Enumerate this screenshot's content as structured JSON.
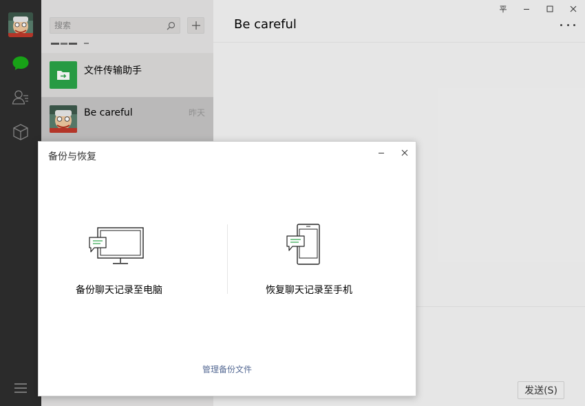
{
  "search": {
    "placeholder": "搜索"
  },
  "chats": [
    {
      "name": "文件传输助手",
      "time": ""
    },
    {
      "name": "Be careful",
      "time": "昨天"
    }
  ],
  "main": {
    "title": "Be careful",
    "send_label": "发送(S)"
  },
  "dialog": {
    "title": "备份与恢复",
    "backup_label": "备份聊天记录至电脑",
    "restore_label": "恢复聊天记录至手机",
    "manage_link": "管理备份文件"
  },
  "window": {
    "pin_glyph": "平"
  },
  "colors": {
    "nav_bg": "#2e2e2e",
    "accent_green": "#1aad19",
    "file_helper_green": "#2aa448",
    "link_blue": "#576b95"
  },
  "icons": [
    "avatar-icon",
    "chat-icon",
    "contacts-icon",
    "favorites-icon",
    "menu-icon",
    "search-icon",
    "plus-icon",
    "file-transfer-icon",
    "more-icon",
    "pin-icon",
    "minimize-icon",
    "maximize-icon",
    "close-icon",
    "monitor-icon",
    "phone-icon"
  ]
}
